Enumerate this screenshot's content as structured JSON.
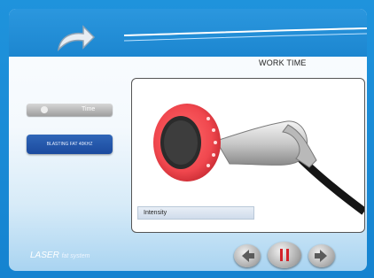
{
  "header": {
    "work_time_label": "WORK TIME"
  },
  "sidebar": {
    "time_button_label": "Time",
    "mode_button_label": "BLASTING FAT 40KHZ"
  },
  "main": {
    "intensity_label": "Intensity"
  },
  "footer": {
    "brand_main": "LASER",
    "brand_sub": "fat system"
  },
  "icons": {
    "back": "back-arrow-icon",
    "prev": "left-arrow-icon",
    "pause": "pause-icon",
    "next": "right-arrow-icon"
  },
  "colors": {
    "accent_blue": "#1c86d0",
    "mode_button": "#1b4a9e",
    "pause_red": "#d2232a"
  }
}
